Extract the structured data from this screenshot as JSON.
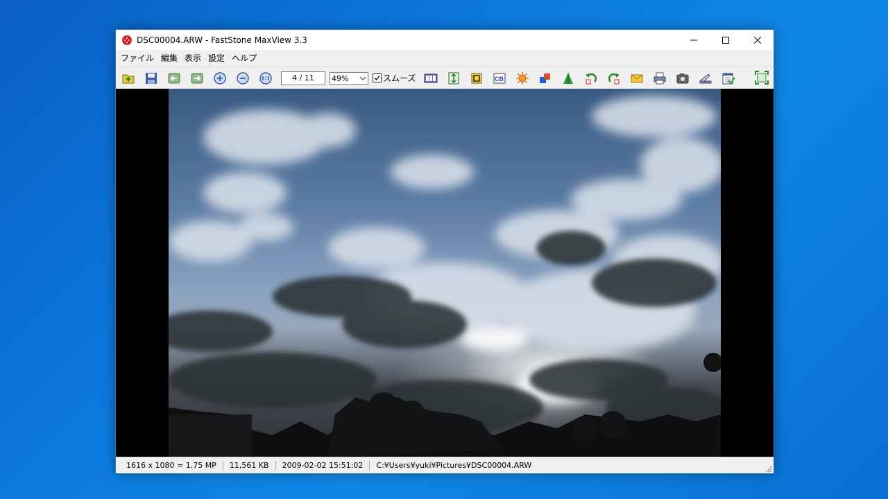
{
  "window": {
    "title": "DSC00004.ARW - FastStone MaxView 3.3"
  },
  "menu": [
    "ファイル",
    "編集",
    "表示",
    "設定",
    "ヘルプ"
  ],
  "toolbar": {
    "page_counter": "4 / 11",
    "zoom_value": "49%",
    "smooth_label": "スムーズ",
    "smooth_checked": true,
    "buttons": [
      "open-folder-icon",
      "save-icon",
      "previous-icon",
      "next-icon",
      "zoom-in-icon",
      "zoom-out-icon",
      "actual-size-icon",
      "slideshow-icon",
      "resize-icon",
      "crop-icon",
      "color-balance-icon",
      "brightness-icon",
      "colors-icon",
      "sharpen-icon",
      "rotate-left-icon",
      "rotate-right-icon",
      "email-icon",
      "print-icon",
      "capture-icon",
      "scanner-icon",
      "properties-icon",
      "fullscreen-icon"
    ]
  },
  "status": {
    "dimensions": "1616 x 1080 = 1.75 MP",
    "file_size": "11,561 KB",
    "datetime": "2009-02-02 15:51:02",
    "path": "C:¥Users¥yuki¥Pictures¥DSC00004.ARW"
  },
  "colors": {
    "desktop": "#0b74d8",
    "window_border": "#2b79d0",
    "chrome": "#f0f0f0"
  }
}
